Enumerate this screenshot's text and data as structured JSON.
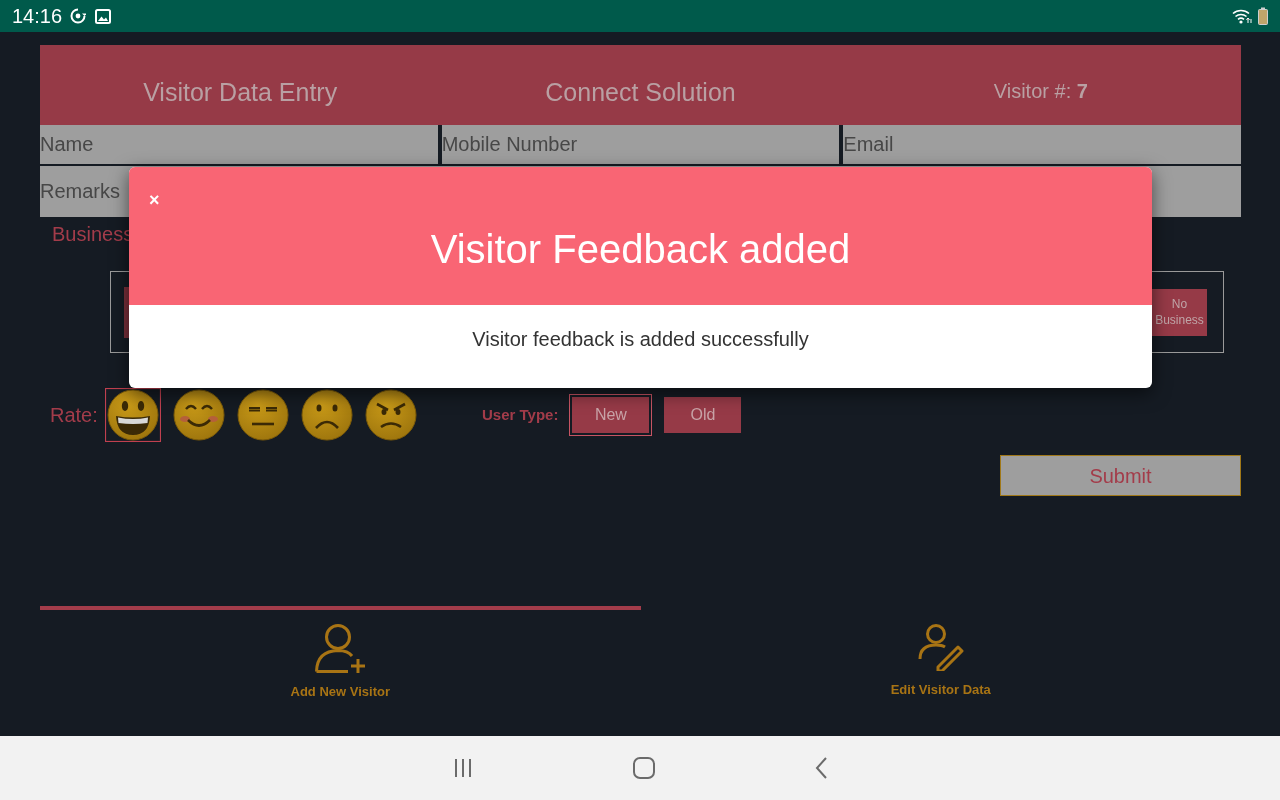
{
  "status_bar": {
    "time": "14:16"
  },
  "header": {
    "title": "Visitor Data Entry",
    "company": "Connect Solution",
    "visitor": "Visitor #: **7**"
  },
  "fields": [
    {
      "placeholder": "Name"
    },
    {
      "placeholder": "Mobile Number"
    },
    {
      "placeholder": "Email"
    }
  ],
  "remarks": {
    "placeholder": "Remarks"
  },
  "business": {
    "label": "Business",
    "options": [
      {
        "label": "No Business"
      }
    ]
  },
  "rating": {
    "label": "Rate:",
    "faces": [
      {
        "kind": "grin",
        "selected": true
      },
      {
        "kind": "smile",
        "selected": false
      },
      {
        "kind": "neutral",
        "selected": false
      },
      {
        "kind": "frown",
        "selected": false
      },
      {
        "kind": "angry",
        "selected": false
      }
    ]
  },
  "user_type": {
    "label": "User Type:",
    "options": [
      {
        "label": "New",
        "selected": true
      },
      {
        "label": "Old",
        "selected": false
      }
    ]
  },
  "submit": "Submit",
  "tabs": [
    {
      "kind": "add",
      "label": "Add New Visitor",
      "selected": true
    },
    {
      "kind": "edit",
      "label": "Edit Visitor Data",
      "selected": false
    }
  ],
  "modal": {
    "close": "×",
    "title": "Visitor Feedback added",
    "message": "Visitor feedback is added successfully"
  }
}
